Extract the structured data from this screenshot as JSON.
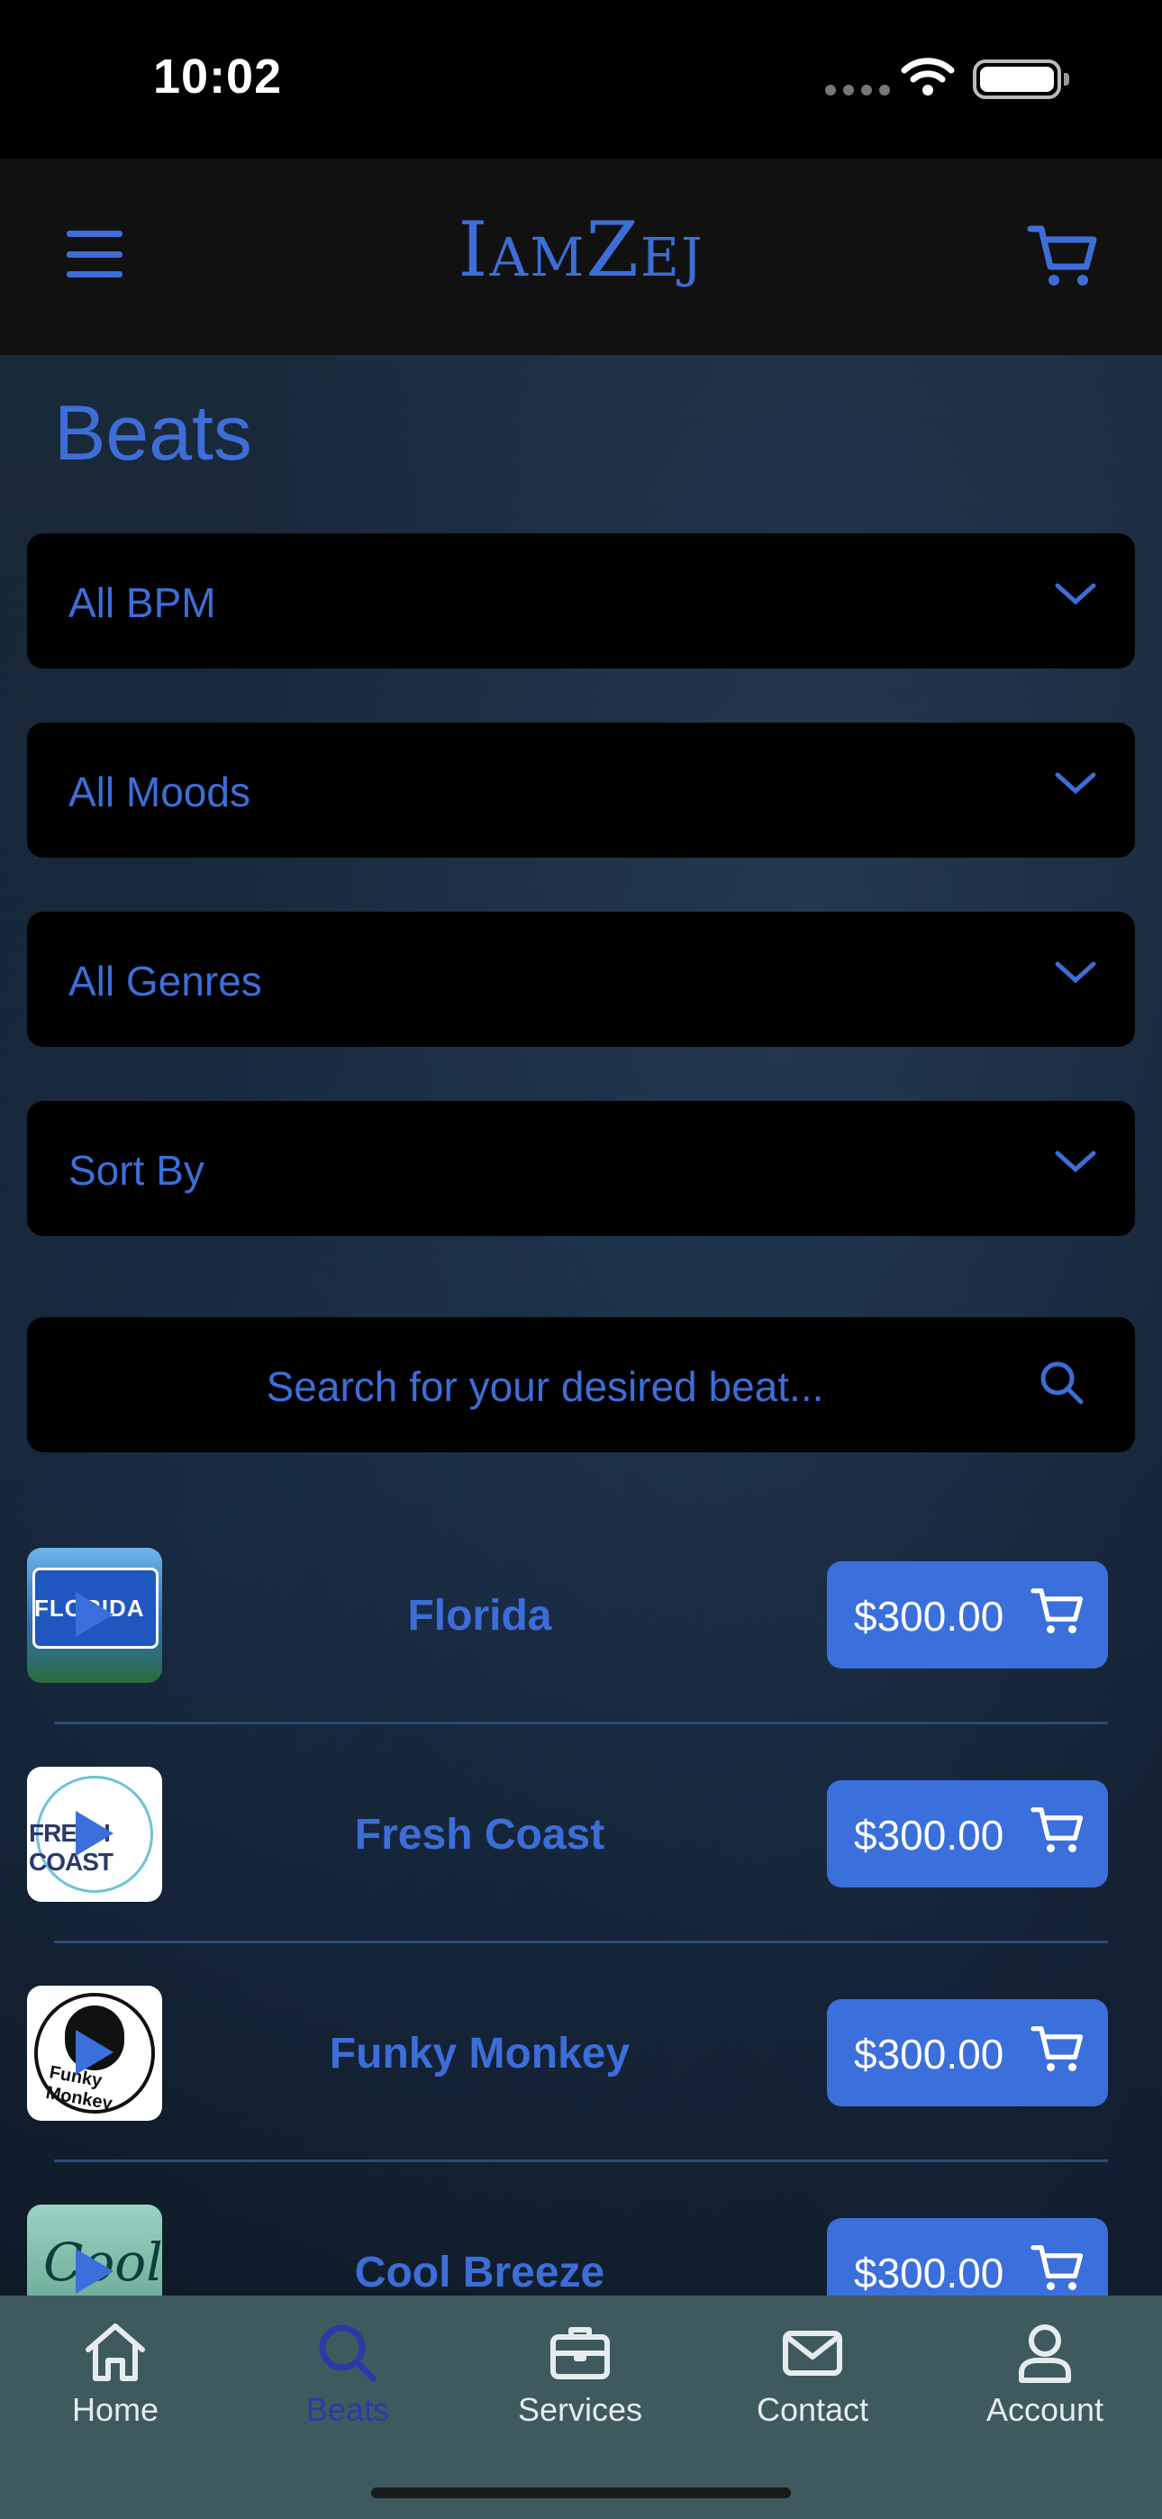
{
  "status_bar": {
    "time": "10:02"
  },
  "header": {
    "brand": "IamZej"
  },
  "page": {
    "title": "Beats"
  },
  "filters": [
    {
      "label": "All BPM"
    },
    {
      "label": "All Moods"
    },
    {
      "label": "All Genres"
    },
    {
      "label": "Sort By"
    }
  ],
  "search": {
    "placeholder": "Search for your desired beat..."
  },
  "beats": [
    {
      "title": "Florida",
      "price": "$300.00",
      "thumb_text": "FLORIDA"
    },
    {
      "title": "Fresh Coast",
      "price": "$300.00",
      "thumb_text": "FRESH COAST"
    },
    {
      "title": "Funky Monkey",
      "price": "$300.00",
      "thumb_text": "Funky Monkey"
    },
    {
      "title": "Cool Breeze",
      "price": "$300.00",
      "thumb_text": "Cool"
    }
  ],
  "tabs": [
    {
      "label": "Home",
      "icon": "home-icon",
      "active": false
    },
    {
      "label": "Beats",
      "icon": "search-icon",
      "active": true
    },
    {
      "label": "Services",
      "icon": "briefcase-icon",
      "active": false
    },
    {
      "label": "Contact",
      "icon": "mail-icon",
      "active": false
    },
    {
      "label": "Account",
      "icon": "person-icon",
      "active": false
    }
  ],
  "colors": {
    "accent": "#3d6ed8",
    "button": "#3b6fdc",
    "tab_bar": "#3f5a5f",
    "header": "#111111"
  }
}
